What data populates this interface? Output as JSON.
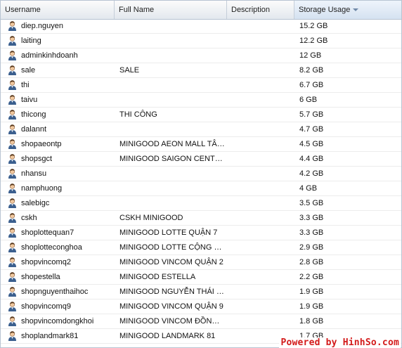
{
  "columns": {
    "username": "Username",
    "full_name": "Full Name",
    "description": "Description",
    "storage_usage": "Storage Usage"
  },
  "sort": {
    "column": "storage_usage",
    "direction": "descending"
  },
  "icons": {
    "user": "user-icon",
    "sort": "sort-descending-icon"
  },
  "rows": [
    {
      "username": "diep.nguyen",
      "full_name": "",
      "description": "",
      "storage": "15.2 GB"
    },
    {
      "username": "laiting",
      "full_name": "",
      "description": "",
      "storage": "12.2 GB"
    },
    {
      "username": "adminkinhdoanh",
      "full_name": "",
      "description": "",
      "storage": "12 GB"
    },
    {
      "username": "sale",
      "full_name": "SALE",
      "description": "",
      "storage": "8.2 GB"
    },
    {
      "username": "thi",
      "full_name": "",
      "description": "",
      "storage": "6.7 GB"
    },
    {
      "username": "taivu",
      "full_name": "",
      "description": "",
      "storage": "6 GB"
    },
    {
      "username": "thicong",
      "full_name": "THI CÔNG",
      "description": "",
      "storage": "5.7 GB"
    },
    {
      "username": "dalannt",
      "full_name": "",
      "description": "",
      "storage": "4.7 GB"
    },
    {
      "username": "shopaeontp",
      "full_name": "MINIGOOD AEON MALL TÂN PHÚ",
      "description": "",
      "storage": "4.5 GB"
    },
    {
      "username": "shopsgct",
      "full_name": "MINIGOOD SAIGON CENTRE",
      "description": "",
      "storage": "4.4 GB"
    },
    {
      "username": "nhansu",
      "full_name": "",
      "description": "",
      "storage": "4.2 GB"
    },
    {
      "username": "namphuong",
      "full_name": "",
      "description": "",
      "storage": "4 GB"
    },
    {
      "username": "salebigc",
      "full_name": "",
      "description": "",
      "storage": "3.5 GB"
    },
    {
      "username": "cskh",
      "full_name": "CSKH MINIGOOD",
      "description": "",
      "storage": "3.3 GB"
    },
    {
      "username": "shoplottequan7",
      "full_name": "MINIGOOD LOTTE QUẬN 7",
      "description": "",
      "storage": "3.3 GB"
    },
    {
      "username": "shoplotteconghoa",
      "full_name": "MINIGOOD LOTTE CỘNG HÒA",
      "description": "",
      "storage": "2.9 GB"
    },
    {
      "username": "shopvincomq2",
      "full_name": "MINIGOOD VINCOM QUẬN 2",
      "description": "",
      "storage": "2.8 GB"
    },
    {
      "username": "shopestella",
      "full_name": "MINIGOOD ESTELLA",
      "description": "",
      "storage": "2.2 GB"
    },
    {
      "username": "shopnguyenthaihoc",
      "full_name": "MINIGOOD NGUYỄN THÁI HỌC",
      "description": "",
      "storage": "1.9 GB"
    },
    {
      "username": "shopvincomq9",
      "full_name": "MINIGOOD VINCOM QUẬN 9",
      "description": "",
      "storage": "1.9 GB"
    },
    {
      "username": "shopvincomdongkhoi",
      "full_name": "MINIGOOD VINCOM ĐỒNG KHỞI",
      "description": "",
      "storage": "1.8 GB"
    },
    {
      "username": "shoplandmark81",
      "full_name": "MINIGOOD LANDMARK 81",
      "description": "",
      "storage": "1.7 GB"
    },
    {
      "username": "",
      "full_name": "",
      "description": "",
      "storage": ""
    }
  ],
  "watermark": "Powered by HinhSo.com",
  "colors": {
    "header_border": "#b8c4d2",
    "sorted_header": "#d5e2f1",
    "watermark": "#d31a1a"
  }
}
